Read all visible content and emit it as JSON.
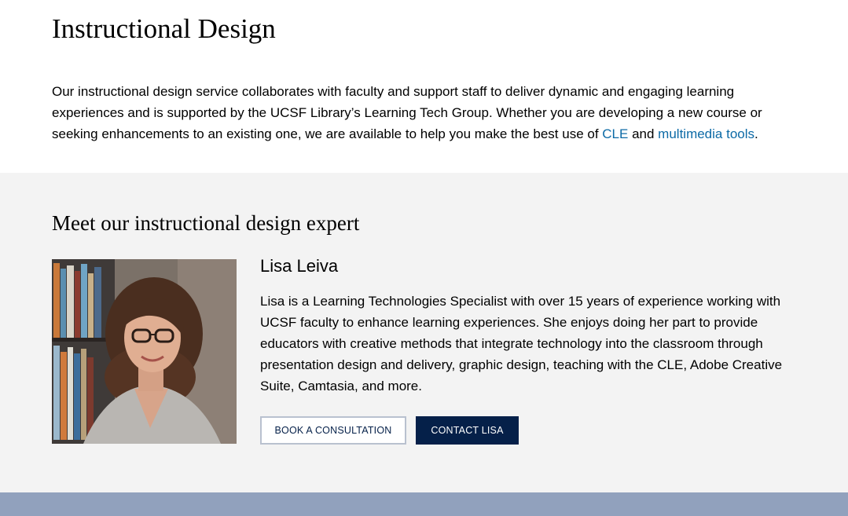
{
  "intro": {
    "title": "Instructional Design",
    "text_before": "Our instructional design service collaborates with faculty and support staff to deliver dynamic and engaging learning experiences and is supported by the UCSF Library’s Learning Tech Group. Whether you are developing a new course or seeking enhancements to an existing one, we are available to help you make the best use of ",
    "link_cle": "CLE",
    "text_middle": " and ",
    "link_multimedia": "multimedia tools",
    "text_after": "."
  },
  "expert": {
    "section_title": "Meet our instructional design expert",
    "name": "Lisa Leiva",
    "bio": "Lisa is a Learning Technologies Specialist with over 15 years of experience working with UCSF faculty to enhance learning experiences. She enjoys doing her part to provide educators with creative methods that integrate technology into the classroom through presentation design and delivery, graphic design, teaching with the CLE, Adobe Creative Suite, Camtasia, and more.",
    "buttons": {
      "consultation": "BOOK A CONSULTATION",
      "contact": "CONTACT LISA"
    }
  },
  "colors": {
    "link": "#0c6aa6",
    "navy": "#052049",
    "section_bg": "#f3f3f3",
    "footer_band": "#91a1bd"
  }
}
